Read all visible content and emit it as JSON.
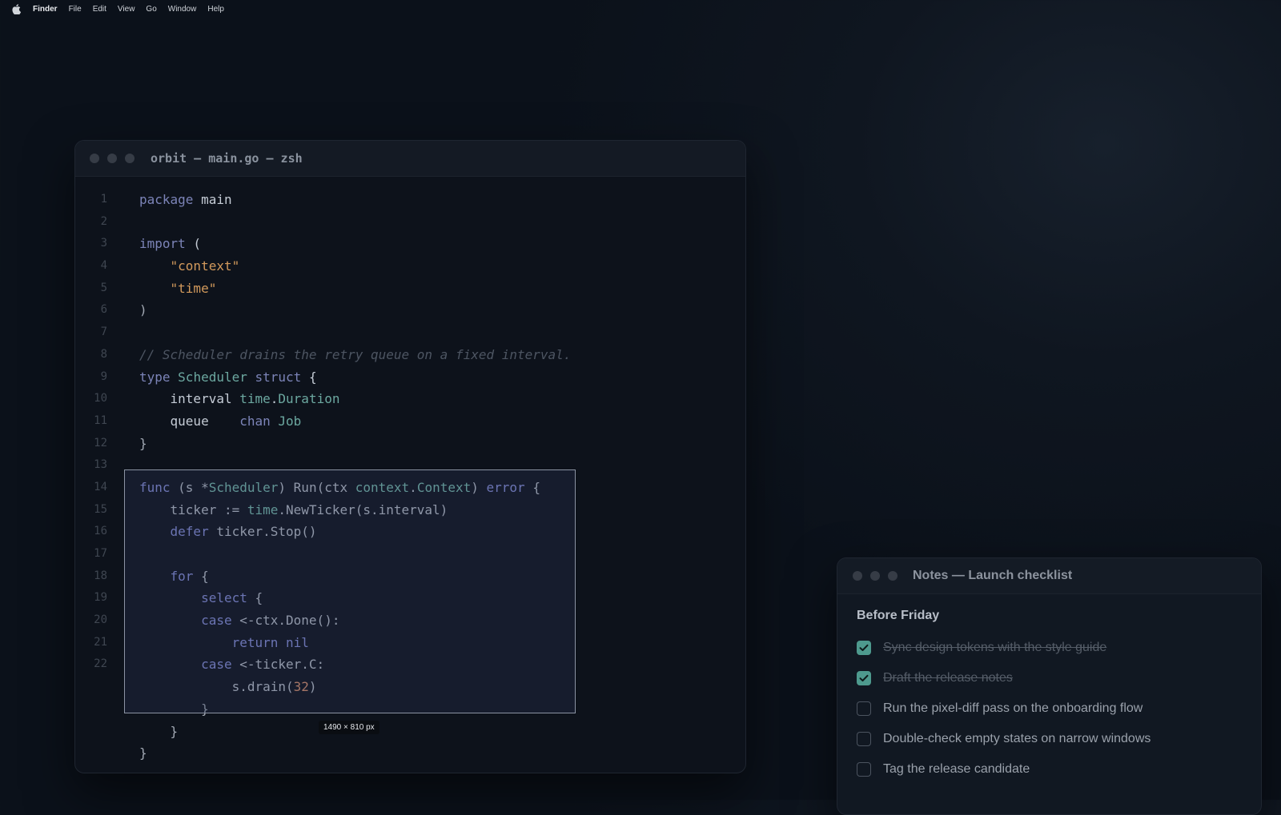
{
  "menubar": {
    "apple_icon": "apple-icon",
    "app_name": "Finder",
    "items": [
      "File",
      "Edit",
      "View",
      "Go",
      "Window",
      "Help"
    ]
  },
  "editor": {
    "title": "orbit — main.go — zsh",
    "line_numbers": [
      "1",
      "2",
      "3",
      "4",
      "5",
      "6",
      "7",
      "8",
      "9",
      "10",
      "11",
      "12",
      "13",
      "14",
      "15",
      "16",
      "17",
      "18",
      "19",
      "20",
      "21",
      "22"
    ],
    "code": {
      "l1_kw": "package",
      "l1_rest": " main",
      "l3_kw": "import",
      "l3_rest": " (",
      "l4_str": "\"context\"",
      "l5_str": "\"time\"",
      "l6": ")",
      "l8_comment": "// Scheduler drains the retry queue on a fixed interval.",
      "l9_kw1": "type",
      "l9_type": "Scheduler",
      "l9_kw2": "struct",
      "l9_rest": " {",
      "l10_field": "interval",
      "l10_pkg": "time",
      "l10_dot": ".",
      "l10_type": "Duration",
      "l11_field": "queue",
      "l11_kw": "chan",
      "l11_type": "Job",
      "l12": "}",
      "l14_kw": "func",
      "l14_a": " (s *",
      "l14_type": "Scheduler",
      "l14_b": ") Run(ctx ",
      "l14_pkg": "context",
      "l14_dot": ".",
      "l14_type2": "Context",
      "l14_c": ") ",
      "l14_kw2": "error",
      "l14_d": " {",
      "l15_a": "ticker := ",
      "l15_pkg": "time",
      "l15_b": ".NewTicker(s.interval)",
      "l16_kw": "defer",
      "l16_rest": " ticker.Stop()",
      "l18_kw": "for",
      "l18_rest": " {",
      "l19_kw": "select",
      "l19_rest": " {",
      "l20_kw": "case",
      "l20_rest": " <-ctx.Done():",
      "l21_kw1": "return",
      "l21_kw2": "nil",
      "l22_kw": "case",
      "l22_rest": " <-ticker.C:",
      "l23_a": "s.drain(",
      "l23_num": "32",
      "l23_b": ")",
      "l24": "}",
      "l25": "}",
      "l26": "}"
    },
    "selection_size": "1490 × 810 px"
  },
  "notes": {
    "title": "Notes — Launch checklist",
    "heading": "Before Friday",
    "items": [
      {
        "text": "Sync design tokens with the style guide",
        "done": true
      },
      {
        "text": "Draft the release notes",
        "done": true
      },
      {
        "text": "Run the pixel-diff pass on the onboarding flow",
        "done": false
      },
      {
        "text": "Double-check empty states on narrow windows",
        "done": false
      },
      {
        "text": "Tag the release candidate",
        "done": false
      }
    ]
  },
  "colors": {
    "accent_check": "#4e9a8e",
    "keyword": "#8f98e8",
    "type": "#7fc8b8",
    "string": "#d39a5c",
    "number": "#e89a72"
  }
}
